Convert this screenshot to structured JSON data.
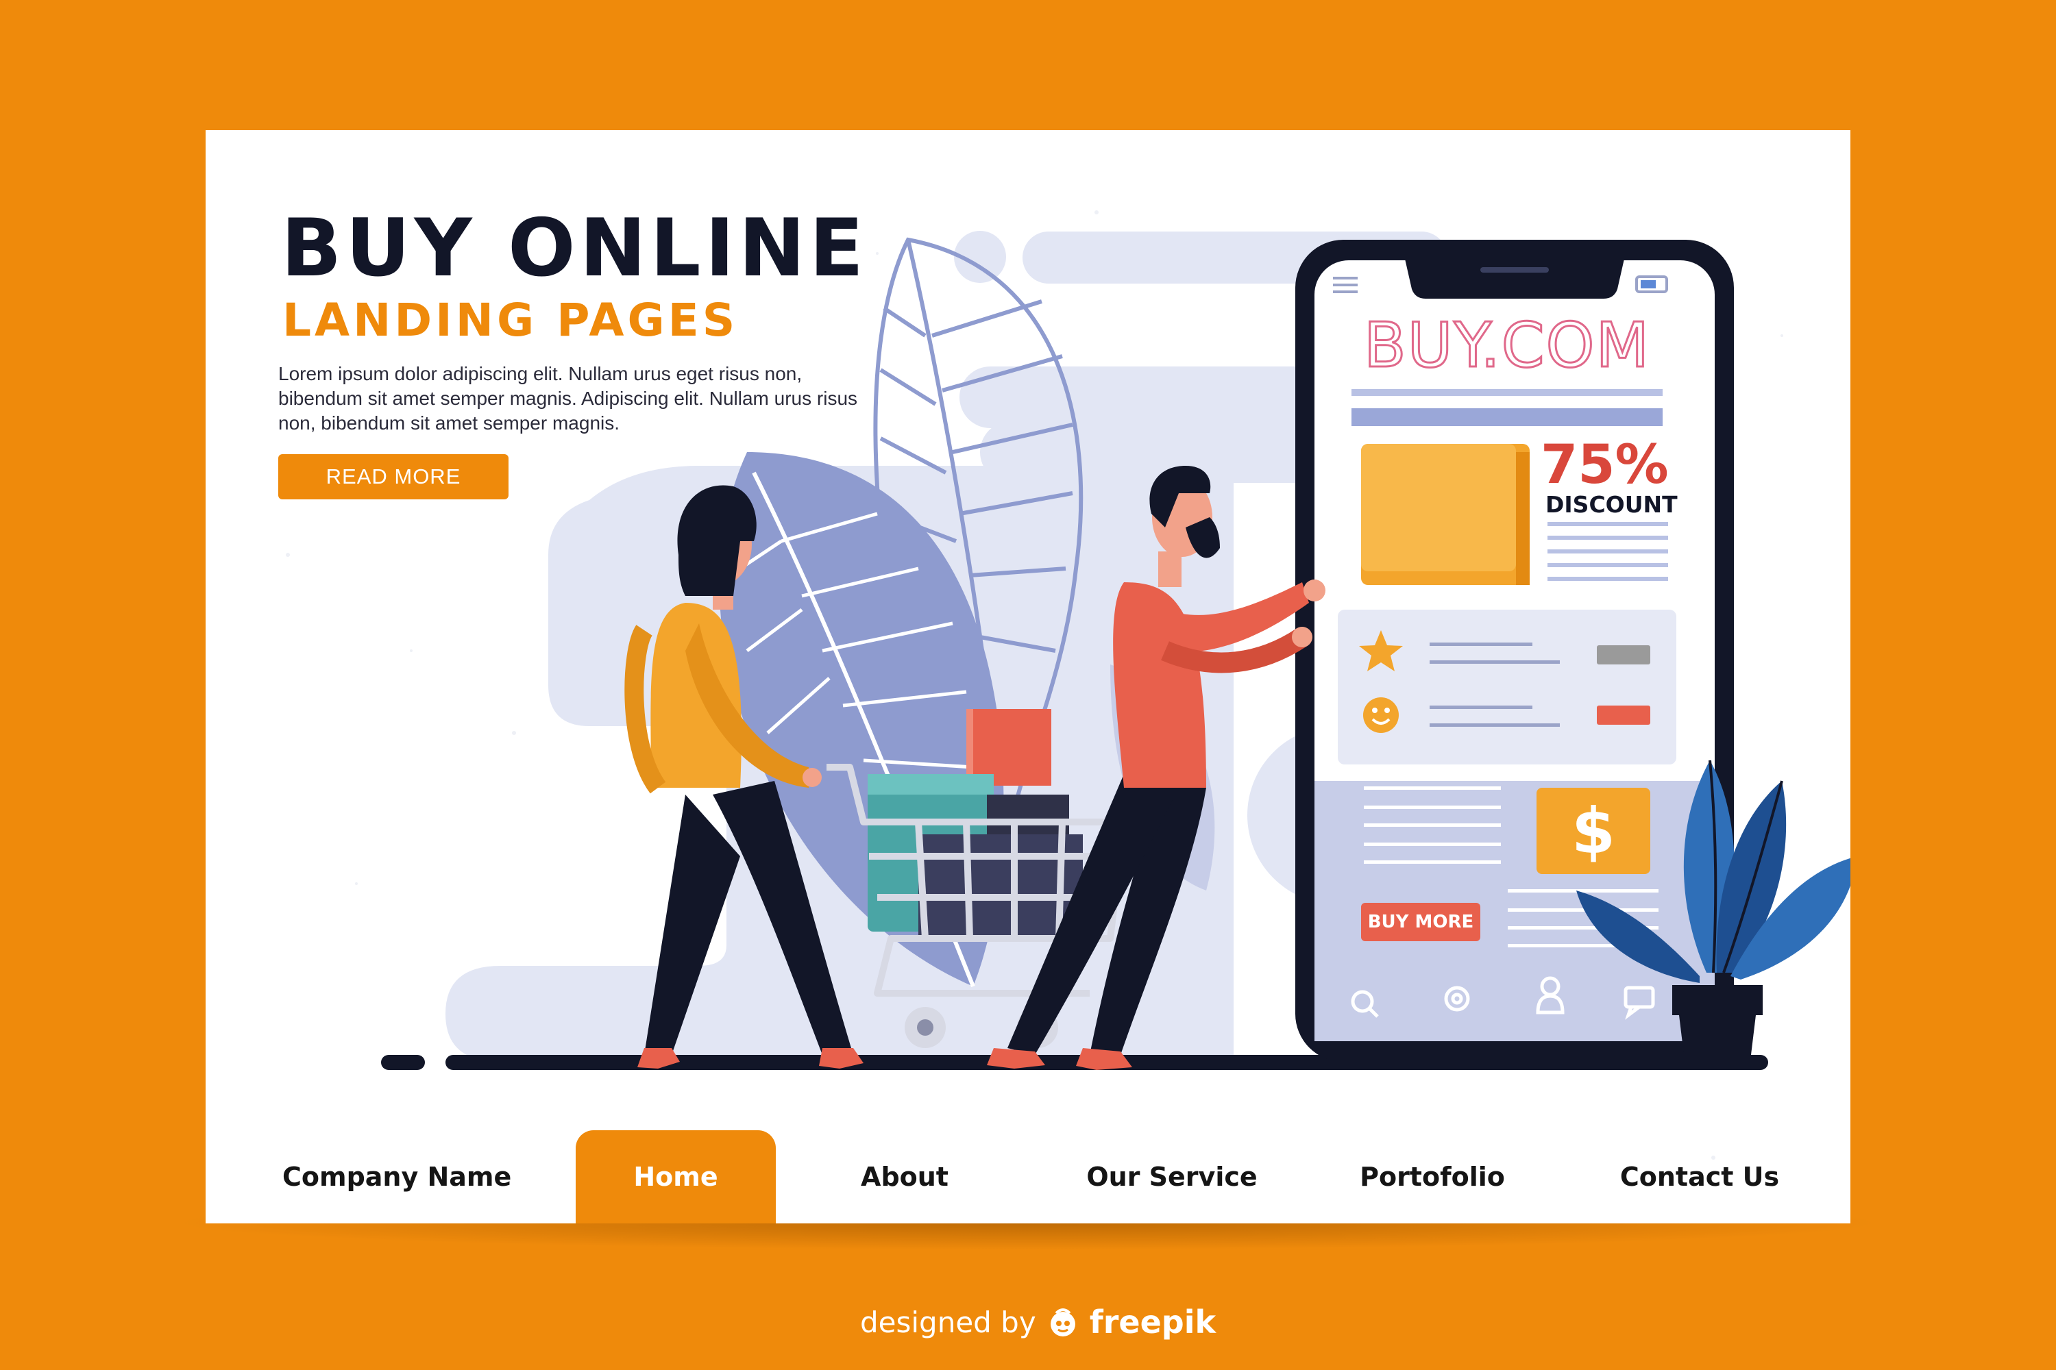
{
  "hero": {
    "title": "BUY ONLINE",
    "subtitle": "LANDING PAGES",
    "body": "Lorem ipsum dolor  adipiscing elit. Nullam urus eget risus non, bibendum sit amet semper magnis. Adipiscing elit. Nullam urus risus non, bibendum sit amet semper magnis.",
    "cta_label": "READ MORE"
  },
  "phone": {
    "site_name": "BUY.COM",
    "discount_value": "75%",
    "discount_label": "DISCOUNT",
    "currency_symbol": "$",
    "buy_button_label": "BUY MORE",
    "bottom_icons": [
      "search-icon",
      "gear-icon",
      "user-icon",
      "chat-icon"
    ]
  },
  "nav": {
    "brand": "Company Name",
    "items": [
      {
        "label": "Home",
        "active": true
      },
      {
        "label": "About",
        "active": false
      },
      {
        "label": "Our Service",
        "active": false
      },
      {
        "label": "Portofolio",
        "active": false
      },
      {
        "label": "Contact Us",
        "active": false
      }
    ]
  },
  "credit": {
    "prefix": "designed by",
    "brand": "freepik"
  },
  "colors": {
    "background": "#ef8a0b",
    "accent": "#ef8a0b",
    "dark": "#121628",
    "coral": "#e8604c",
    "lavender": "#dfe3f3",
    "blue": "#2f6fb8"
  }
}
